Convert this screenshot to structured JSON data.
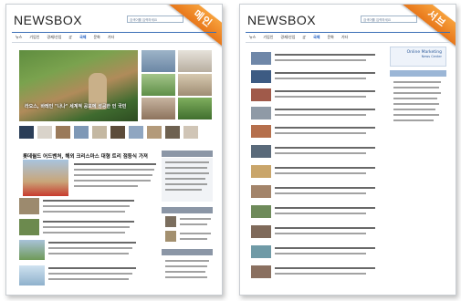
{
  "panels": [
    {
      "id": "main",
      "brand": "NEWSBOX",
      "badge": "메인",
      "search_placeholder": "검색어를 입력하세요",
      "nav": [
        "뉴스",
        "기업인",
        "경제/산업",
        "IT",
        "국제",
        "문화",
        "기타"
      ],
      "nav_active_index": 4,
      "hero_caption": "라오스, 바레인 \"나나\" 세계적 공포에 성공한 인 국민",
      "section_title": "롯데월드 어드벤처, 해외 크리스마스 대형 트리 점등식 가져"
    },
    {
      "id": "sub",
      "brand": "NEWSBOX",
      "badge": "서브",
      "search_placeholder": "검색어를 입력하세요",
      "nav": [
        "뉴스",
        "기업인",
        "경제/산업",
        "IT",
        "국제",
        "문화",
        "기타"
      ],
      "nav_active_index": 4,
      "side_title": "Online Marketing",
      "side_subtitle": "News Center"
    }
  ],
  "colors": {
    "accent": "#f0892a",
    "nav_line": "#3b6fb6",
    "text": "#222222"
  }
}
